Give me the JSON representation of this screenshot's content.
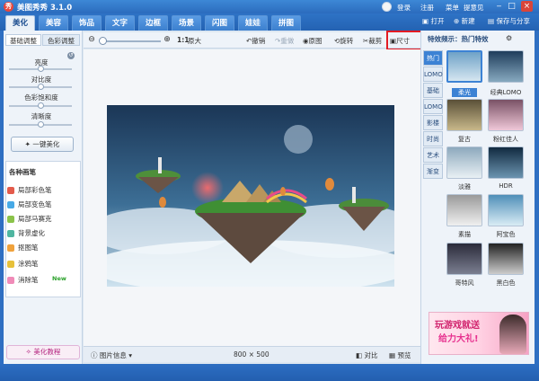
{
  "app": {
    "title": "美图秀秀 3.1.0",
    "logo": "秀"
  },
  "topbar": {
    "login": "登录",
    "register": "注册",
    "menu": "菜单",
    "help": "提意见"
  },
  "tabs": [
    "美化",
    "美容",
    "饰品",
    "文字",
    "边框",
    "场景",
    "闪图",
    "娃娃",
    "拼图"
  ],
  "file_actions": {
    "open": "打开",
    "new": "新建",
    "save": "保存与分享"
  },
  "left": {
    "tabs": [
      "基础调整",
      "色彩调整"
    ],
    "sliders": [
      {
        "label": "亮度",
        "value": 0.5
      },
      {
        "label": "对比度",
        "value": 0.5
      },
      {
        "label": "色彩饱和度",
        "value": 0.5
      },
      {
        "label": "清晰度",
        "value": 0.5
      }
    ],
    "one_key": "一键美化",
    "brush_title": "各种画笔",
    "brushes": [
      "局部彩色笔",
      "局部变色笔",
      "局部马赛克",
      "背景虚化",
      "抠图笔",
      "涂鸦笔",
      "消除笔"
    ],
    "new_badge": "New",
    "tutorial": "美化教程"
  },
  "toolbar": {
    "ratio": "1:1",
    "original": "原大",
    "undo": "撤销",
    "redo": "重做",
    "original_image": "原图",
    "rotate": "旋转",
    "crop": "裁剪",
    "size": "尺寸"
  },
  "status": {
    "image_info": "图片信息",
    "dimensions": "800 × 500",
    "compare": "对比",
    "preview": "预览"
  },
  "right": {
    "header": "特效频示：热门特效",
    "categories": [
      "热门",
      "LOMO",
      "基础",
      "LOMO",
      "影楼",
      "时尚",
      "艺术",
      "渐变"
    ],
    "effects": [
      "柔光",
      "经典LOMO",
      "复古",
      "粉红佳人",
      "淡雅",
      "HDR",
      "素描",
      "阿宝色",
      "哥特风",
      "黑白色"
    ],
    "selected_effect": "柔光",
    "ad_line1": "玩游戏就送",
    "ad_line2": "给力大礼!"
  },
  "colors": {
    "accent": "#2f6fc2",
    "highlight": "#e31b23",
    "selected_tab": "#3c82d4"
  }
}
